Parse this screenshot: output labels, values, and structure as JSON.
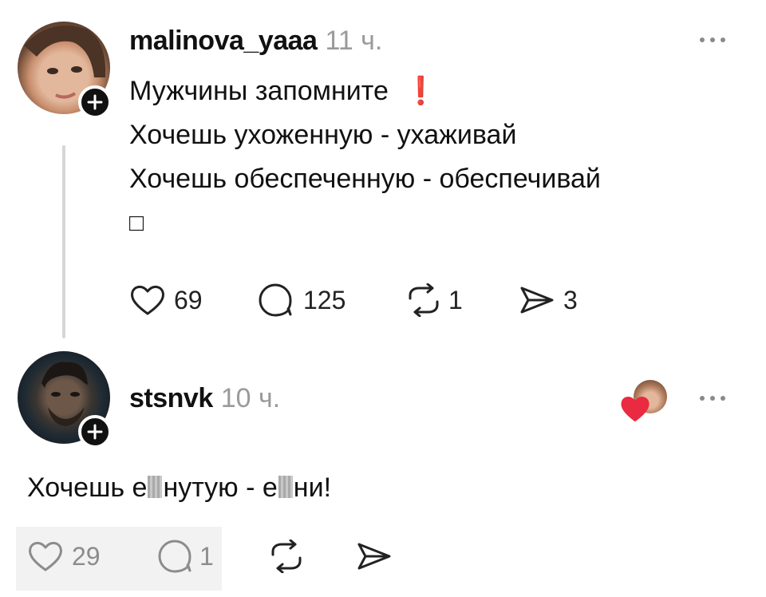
{
  "posts": [
    {
      "username": "malinova_yaaa",
      "time": "11 ч.",
      "lines": [
        "Мужчины запомните",
        "Хочешь ухоженную  - ухаживай",
        "Хочешь обеспеченную - обеспечивай",
        "□"
      ],
      "exclamation": "❗",
      "stats": {
        "likes": "69",
        "comments": "125",
        "reposts": "1",
        "shares": "3"
      },
      "icons": [
        "heart-icon",
        "comment-icon",
        "repost-icon",
        "send-icon",
        "more-icon",
        "follow-plus-icon"
      ]
    },
    {
      "username": "stsnvk",
      "time": "10 ч.",
      "text_parts": [
        "Хочешь е",
        "нутую - е",
        "ни!"
      ],
      "stats": {
        "likes": "29",
        "comments": "1"
      },
      "icons": [
        "heart-icon",
        "comment-icon",
        "repost-icon",
        "send-icon",
        "more-icon",
        "follow-plus-icon",
        "liked-by-author-heart-icon"
      ]
    }
  ],
  "colors": {
    "text": "#111111",
    "muted": "#9a9a9a",
    "thread_line": "#d6d6d6",
    "exclamation": "#d62a2a",
    "heart": "#ea2a40"
  }
}
